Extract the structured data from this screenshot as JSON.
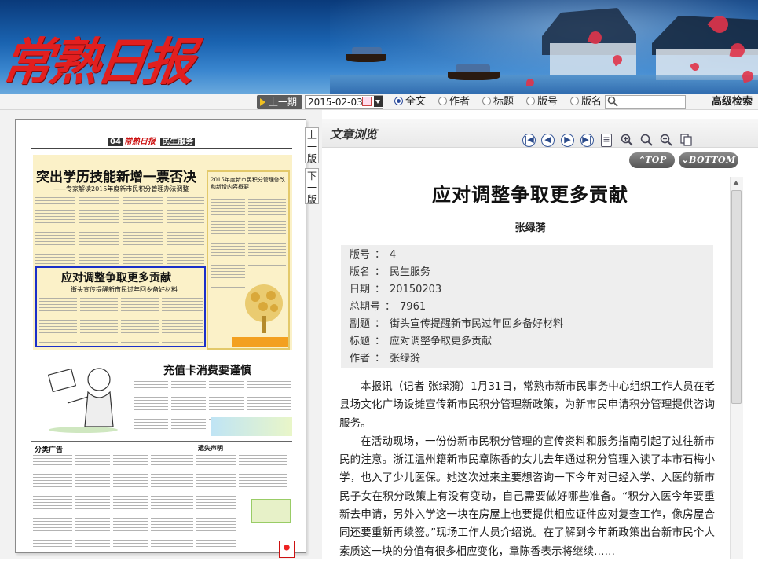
{
  "banner": {
    "logo_text": "常熟日报"
  },
  "searchbar": {
    "prev_issue_label": "上一期",
    "date_value": "2015-02-03",
    "options": [
      {
        "label": "全文",
        "selected": true
      },
      {
        "label": "作者",
        "selected": false
      },
      {
        "label": "标题",
        "selected": false
      },
      {
        "label": "版号",
        "selected": false
      },
      {
        "label": "版名",
        "selected": false
      }
    ],
    "search_placeholder": "",
    "advanced_label": "高级检索"
  },
  "page_preview": {
    "side_tabs": {
      "prev_page": "上一版",
      "next_page": "下一版"
    },
    "page_no": "04",
    "paper_name": "常熟日报",
    "section": "民生服务",
    "headline_1": "突出学历技能新增一票否决",
    "subhead_1": "——专家解读2015年度新市民积分管理办法调整",
    "sidebar_head": "2015年度新市民积分管理修改和新增内容概要",
    "highlight_head": "应对调整争取更多贡献",
    "highlight_sub": "街头宣传提醒新市民过年回乡备好材料",
    "headline_2": "充值卡消费要谨慎",
    "classified_label": "分类广告",
    "lost_notice": "遗失声明"
  },
  "toolbar": {
    "title": "文章浏览",
    "icons": [
      "first-page-icon",
      "prev-icon",
      "next-icon",
      "last-page-icon",
      "document-icon",
      "zoom-in-icon",
      "search-icon",
      "zoom-out-icon",
      "copy-icon"
    ],
    "top_label": "TOP",
    "bottom_label": "BOTTOM"
  },
  "article": {
    "title": "应对调整争取更多贡献",
    "author": "张绿漪",
    "meta": [
      {
        "label": "版号",
        "value": "4"
      },
      {
        "label": "版名",
        "value": "民生服务"
      },
      {
        "label": "日期",
        "value": "20150203"
      },
      {
        "label": "总期号",
        "value": "7961"
      },
      {
        "label": "副题",
        "value": "街头宣传提醒新市民过年回乡备好材料"
      },
      {
        "label": "标题",
        "value": "应对调整争取更多贡献"
      },
      {
        "label": "作者",
        "value": "张绿漪"
      }
    ],
    "meta_sep": "：",
    "paragraphs": [
      "本报讯（记者 张绿漪）1月31日，常熟市新市民事务中心组织工作人员在老县场文化广场设摊宣传新市民积分管理新政策，为新市民申请积分管理提供咨询服务。",
      "在活动现场，一份份新市民积分管理的宣传资料和服务指南引起了过往新市民的注意。浙江温州籍新市民章陈香的女儿去年通过积分管理入读了本市石梅小学，也入了少儿医保。她这次过来主要想咨询一下今年对已经入学、入医的新市民子女在积分政策上有没有变动，自己需要做好哪些准备。“积分入医今年要重新去申请，另外入学这一块在房屋上也要提供相应证件应对复查工作，像房屋合同还要重新再续签。”现场工作人员介绍说。在了解到今年新政策出台新市民个人素质这一块的分值有很多相应变化，章陈香表示将继续……"
    ]
  }
}
